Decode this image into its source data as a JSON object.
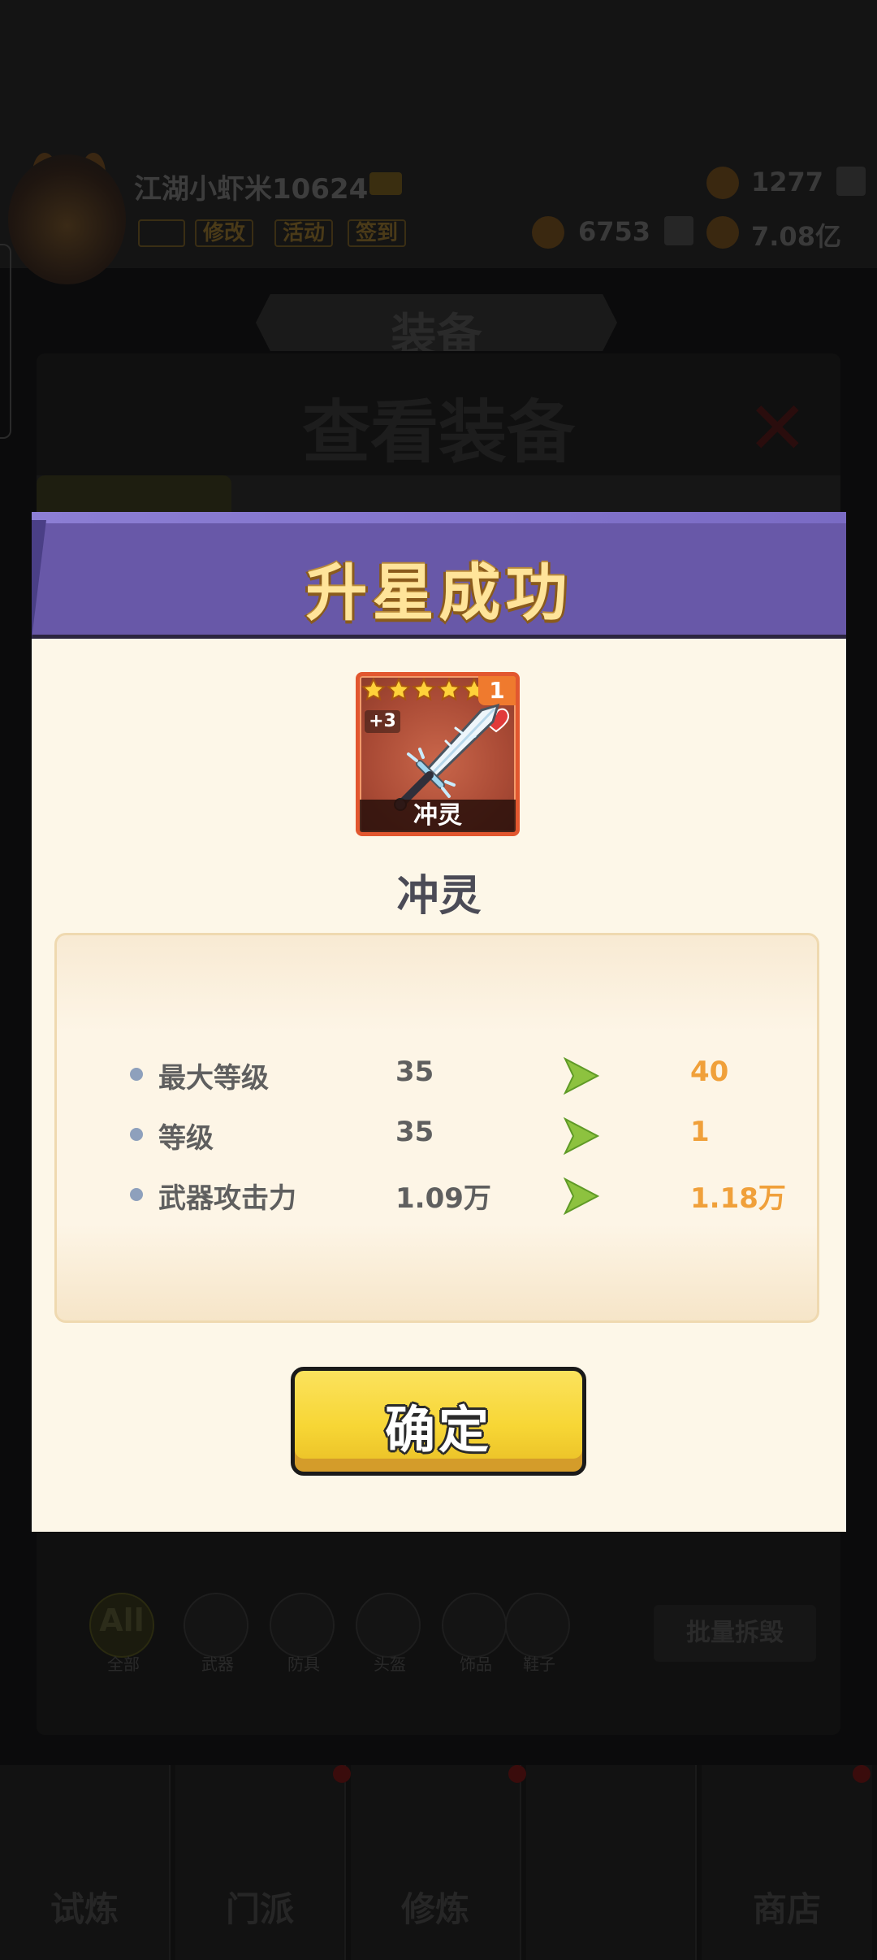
{
  "background": {
    "player_name": "江湖小虾米10624",
    "tags": [
      "",
      "修改",
      "活动",
      "签到"
    ],
    "resources": {
      "stamina": "1277",
      "gems": "6753",
      "gold": "7.08亿"
    },
    "section_banner": "装备",
    "panel_title": "查看装备",
    "filter_all_icon": "All",
    "filters": [
      "全部",
      "武器",
      "防具",
      "头盔",
      "饰品",
      "鞋子"
    ],
    "batch_button": "批量拆毁",
    "nav": [
      "试炼",
      "门派",
      "修炼",
      "",
      "商店"
    ]
  },
  "modal": {
    "title": "升星成功",
    "item": {
      "name": "冲灵",
      "card_label": "冲灵",
      "stars": 5,
      "quantity": "1",
      "enhance": "+3",
      "icon": "sword-icon"
    },
    "stats": [
      {
        "label": "最大等级",
        "old": "35",
        "new": "40"
      },
      {
        "label": "等级",
        "old": "35",
        "new": "1"
      },
      {
        "label": "武器攻击力",
        "old": "1.09万",
        "new": "1.18万"
      }
    ],
    "confirm_label": "确定"
  },
  "colors": {
    "header_purple": "#6858a8",
    "title_gold": "#ffe49a",
    "new_value_orange": "#f0a03a",
    "arrow_green": "#8dc23f",
    "button_yellow": "#f7d635"
  }
}
